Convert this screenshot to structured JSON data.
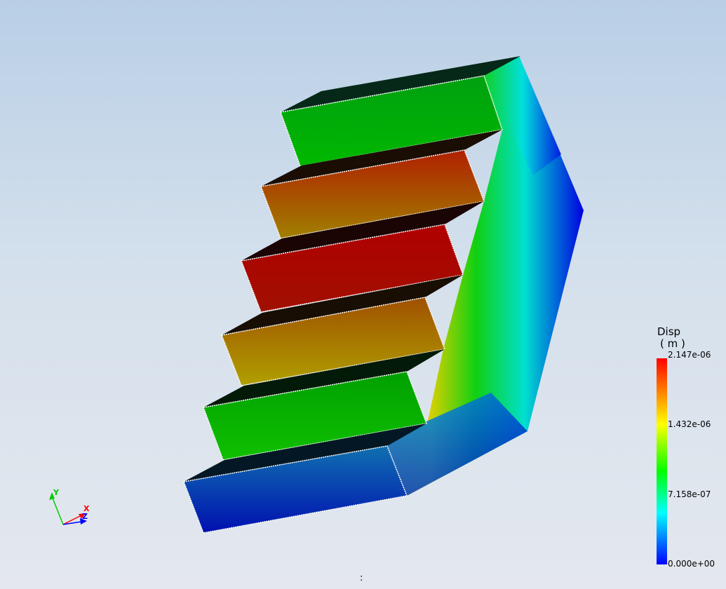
{
  "legend": {
    "title": "Disp",
    "unit": "( m )",
    "max_label": "2.147e-06",
    "mid_high_label": "1.432e-06",
    "mid_low_label": "7.158e-07",
    "min_label": "0.000e+00",
    "colors": [
      "#ff0000",
      "#ffff00",
      "#00ff00",
      "#00ffff",
      "#0000ff"
    ]
  },
  "triad": {
    "y_label": "Y",
    "x_label": "X",
    "z_label": "Z",
    "y_color": "#00cc00",
    "x_color": "#ff0000",
    "z_color": "#0000ff"
  },
  "status": {
    "text": ":"
  }
}
